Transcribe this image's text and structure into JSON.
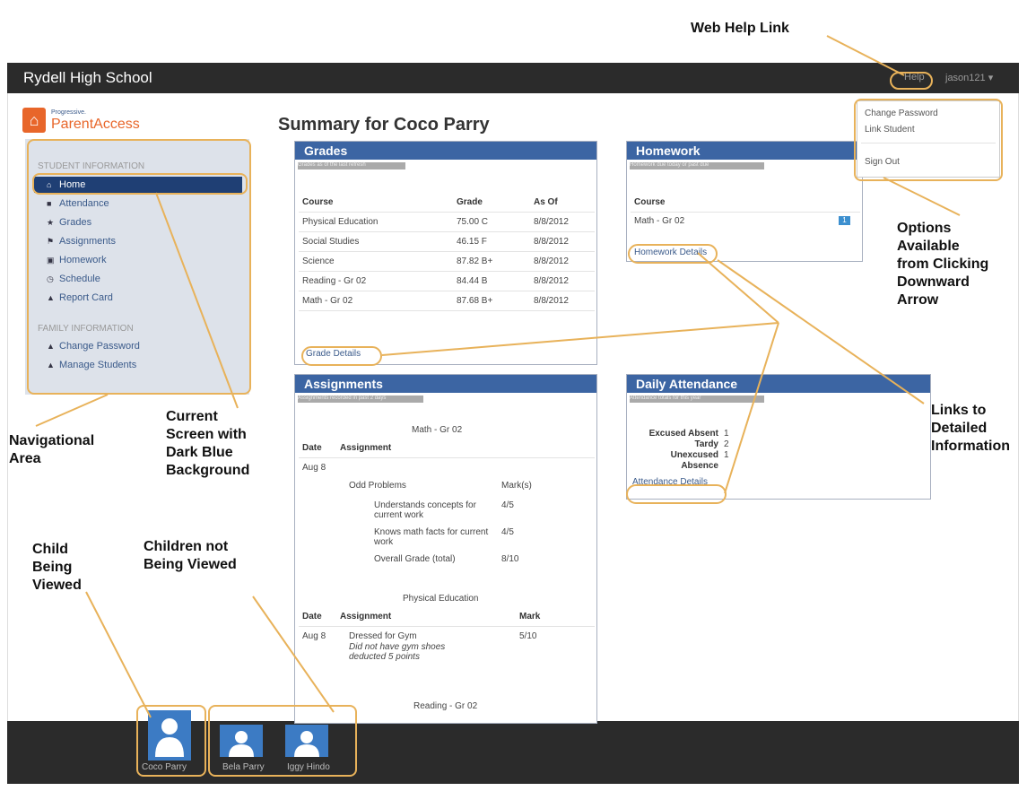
{
  "app": {
    "school": "Rydell High School",
    "help": "Help",
    "user": "jason121 ▾"
  },
  "logo": {
    "tagline": "Progressive.",
    "name": "ParentAccess"
  },
  "sidebar": {
    "section1": "STUDENT INFORMATION",
    "items": [
      {
        "icon": "home-icon",
        "glyph": "⌂",
        "label": "Home",
        "active": true
      },
      {
        "icon": "calendar-icon",
        "glyph": "■",
        "label": "Attendance"
      },
      {
        "icon": "star-icon",
        "glyph": "★",
        "label": "Grades"
      },
      {
        "icon": "flag-icon",
        "glyph": "⚑",
        "label": "Assignments"
      },
      {
        "icon": "book-icon",
        "glyph": "▣",
        "label": "Homework"
      },
      {
        "icon": "clock-icon",
        "glyph": "◷",
        "label": "Schedule"
      },
      {
        "icon": "report-icon",
        "glyph": "▲",
        "label": "Report Card"
      }
    ],
    "section2": "FAMILY INFORMATION",
    "items2": [
      {
        "icon": "lock-icon",
        "glyph": "▲",
        "label": "Change Password"
      },
      {
        "icon": "user-icon",
        "glyph": "▲",
        "label": "Manage Students"
      }
    ]
  },
  "page": {
    "title": "Summary for Coco Parry"
  },
  "grades": {
    "title": "Grades",
    "sub": "Grades as of the last refresh",
    "headers": [
      "Course",
      "Grade",
      "As Of"
    ],
    "rows": [
      [
        "Physical Education",
        "75.00 C",
        "8/8/2012"
      ],
      [
        "Social Studies",
        "46.15 F",
        "8/8/2012"
      ],
      [
        "Science",
        "87.82 B+",
        "8/8/2012"
      ],
      [
        "Reading - Gr 02",
        "84.44 B",
        "8/8/2012"
      ],
      [
        "Math - Gr 02",
        "87.68 B+",
        "8/8/2012"
      ]
    ],
    "link": "Grade Details"
  },
  "homework": {
    "title": "Homework",
    "sub": "Homework due today or past due",
    "header": "Course",
    "row": "Math - Gr 02",
    "count": "1",
    "link": "Homework Details"
  },
  "assignments": {
    "title": "Assignments",
    "sub": "Assignments recorded in past 2 days",
    "group1": "Math - Gr 02",
    "h_date": "Date",
    "h_assignment": "Assignment",
    "h_mark": "Mark",
    "date1": "Aug 8",
    "item1": "Odd Problems",
    "item1_mark": "Mark(s)",
    "sub1": "Understands concepts for current work",
    "sub1_mark": "4/5",
    "sub2": "Knows math facts for current work",
    "sub2_mark": "4/5",
    "sub3": "Overall Grade (total)",
    "sub3_mark": "8/10",
    "group2": "Physical Education",
    "date2": "Aug 8",
    "item2": "Dressed for Gym",
    "item2_note": "Did not have gym shoes deducted 5 points",
    "item2_mark": "5/10",
    "group3": "Reading - Gr 02"
  },
  "attendance": {
    "title": "Daily Attendance",
    "sub": "Attendance totals for this year",
    "rows": [
      [
        "Excused Absent",
        "1"
      ],
      [
        "Tardy",
        "2"
      ],
      [
        "Unexcused",
        "1"
      ]
    ],
    "row_extra": "Absence",
    "link": "Attendance Details"
  },
  "dropdown": {
    "items": [
      "Change Password",
      "Link Student",
      "Sign Out"
    ]
  },
  "children": [
    "Coco Parry",
    "Bela Parry",
    "Iggy Hindo"
  ],
  "annotations": {
    "web_help": "Web Help Link",
    "options": [
      "Options",
      "Available",
      "from Clicking",
      "Downward",
      "Arrow"
    ],
    "links": [
      "Links to",
      "Detailed",
      "Information"
    ],
    "nav": [
      "Navigational",
      "Area"
    ],
    "current": [
      "Current",
      "Screen with",
      "Dark Blue",
      "Background"
    ],
    "child": [
      "Child",
      "Being",
      "Viewed"
    ],
    "not_viewed": [
      "Children not",
      "Being Viewed"
    ]
  },
  "colors": {
    "accent": "#e8b25a",
    "panel_header": "#3c65a3",
    "nav_active": "#1f3f74",
    "logo": "#e8662a"
  }
}
